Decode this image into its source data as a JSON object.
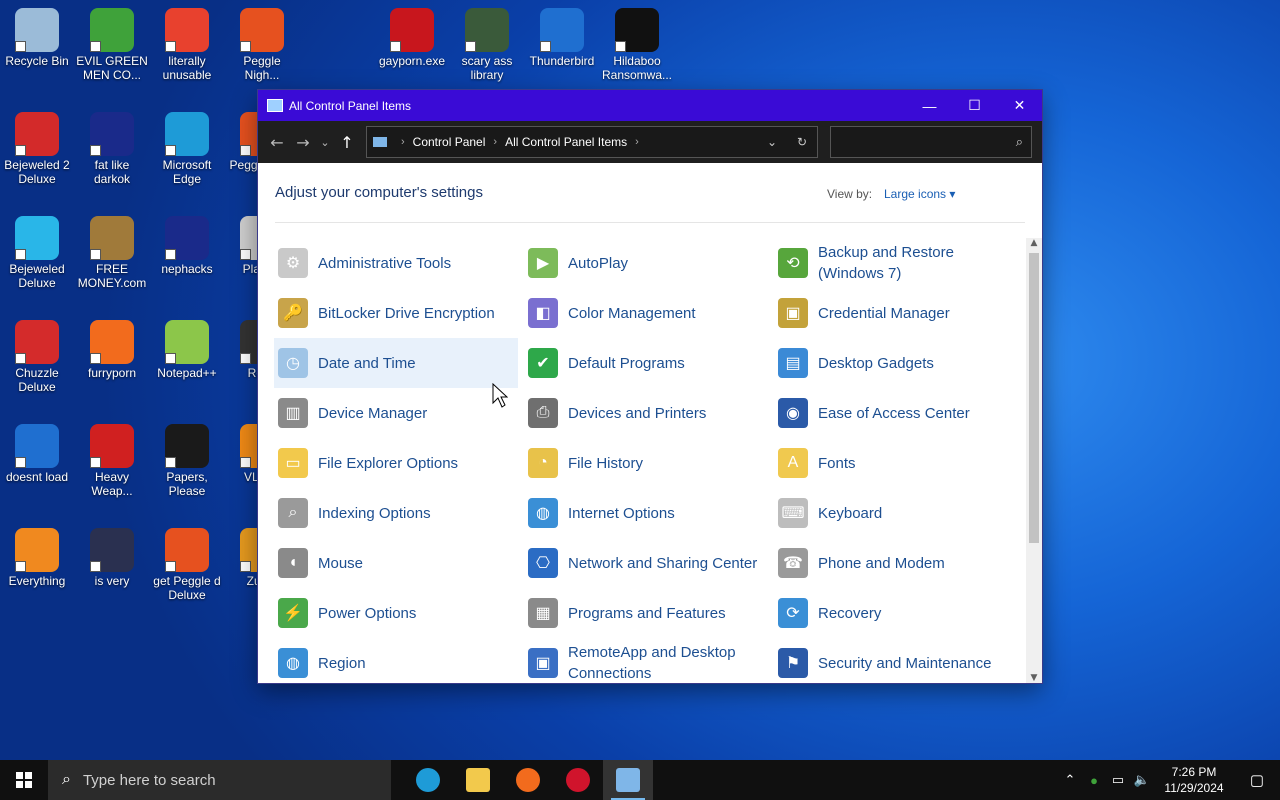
{
  "desktop": {
    "icons": [
      {
        "label": "Recycle Bin",
        "color": "#9bbbd8"
      },
      {
        "label": "EVIL GREEN MEN CO...",
        "color": "#3fa23a"
      },
      {
        "label": "literally unusable",
        "color": "#e8412e"
      },
      {
        "label": "Peggle Nigh...",
        "color": "#e6511f"
      },
      {
        "label": "gayporn.exe",
        "color": "#c8161d"
      },
      {
        "label": "scary ass library",
        "color": "#3a5a3a"
      },
      {
        "label": "Thunderbird",
        "color": "#1f6fd0"
      },
      {
        "label": "Hildaboo Ransomwa...",
        "color": "#111111"
      },
      {
        "label": "Bejeweled 2 Deluxe",
        "color": "#d32a2a"
      },
      {
        "label": "fat like darkok",
        "color": "#1a2a8a"
      },
      {
        "label": "Microsoft Edge",
        "color": "#1e9bd7"
      },
      {
        "label": "Peggl of Wa",
        "color": "#e6511f"
      },
      {
        "label": "Bejeweled Deluxe",
        "color": "#29b6e8"
      },
      {
        "label": "FREE MONEY.com",
        "color": "#a07a3a"
      },
      {
        "label": "nephacks",
        "color": "#1a2a8a"
      },
      {
        "label": "Pla Zor",
        "color": "#cfcfcf"
      },
      {
        "label": "Chuzzle Deluxe",
        "color": "#d42b2b"
      },
      {
        "label": "furryporn",
        "color": "#f26b1d"
      },
      {
        "label": "Notepad++",
        "color": "#8cc64a"
      },
      {
        "label": "Ro M",
        "color": "#333333"
      },
      {
        "label": "doesnt load",
        "color": "#1f6fd0"
      },
      {
        "label": "Heavy Weap...",
        "color": "#d02020"
      },
      {
        "label": "Papers, Please",
        "color": "#1a1a1a"
      },
      {
        "label": "VLC pl",
        "color": "#f08a16"
      },
      {
        "label": "Everything",
        "color": "#f0891f"
      },
      {
        "label": "is very",
        "color": "#2a3050"
      },
      {
        "label": "get Peggle d Deluxe",
        "color": "#e6511f"
      },
      {
        "label": "Zuma",
        "color": "#e69a1f"
      }
    ]
  },
  "window": {
    "title": "All Control Panel Items",
    "controls": {
      "minimize": "—",
      "maximize": "☐",
      "close": "✕"
    },
    "nav": {
      "back": "←",
      "forward": "→",
      "recent": "⌄",
      "up": "↑",
      "refresh": "↻",
      "dropdown": "⌄",
      "search_glyph": "⌕"
    },
    "breadcrumb": [
      "Control Panel",
      "All Control Panel Items"
    ],
    "search_placeholder": "",
    "heading": "Adjust your computer's settings",
    "view_by_label": "View by:",
    "view_by_value": "Large icons ▾",
    "items": [
      {
        "label": "Administrative Tools",
        "icon": "tools-icon",
        "color": "#c9c9c9",
        "glyph": "⚙"
      },
      {
        "label": "AutoPlay",
        "icon": "autoplay-icon",
        "color": "#7dbb5a",
        "glyph": "▶"
      },
      {
        "label": "Backup and Restore (Windows 7)",
        "icon": "backup-icon",
        "color": "#57a63c",
        "glyph": "⟲"
      },
      {
        "label": "BitLocker Drive Encryption",
        "icon": "bitlocker-icon",
        "color": "#c8a44a",
        "glyph": "🔑"
      },
      {
        "label": "Color Management",
        "icon": "color-management-icon",
        "color": "#7a6fd0",
        "glyph": "◧"
      },
      {
        "label": "Credential Manager",
        "icon": "credential-icon",
        "color": "#c3a23a",
        "glyph": "▣"
      },
      {
        "label": "Date and Time",
        "icon": "date-time-icon",
        "color": "#9fc4e6",
        "glyph": "◷"
      },
      {
        "label": "Default Programs",
        "icon": "default-programs-icon",
        "color": "#2ea84a",
        "glyph": "✔"
      },
      {
        "label": "Desktop Gadgets",
        "icon": "gadgets-icon",
        "color": "#3b8ad6",
        "glyph": "▤"
      },
      {
        "label": "Device Manager",
        "icon": "device-manager-icon",
        "color": "#8a8a8a",
        "glyph": "▥"
      },
      {
        "label": "Devices and Printers",
        "icon": "printer-icon",
        "color": "#6f6f6f",
        "glyph": "⎙"
      },
      {
        "label": "Ease of Access Center",
        "icon": "ease-access-icon",
        "color": "#2b5aa8",
        "glyph": "◉"
      },
      {
        "label": "File Explorer Options",
        "icon": "folder-options-icon",
        "color": "#f2c94c",
        "glyph": "▭"
      },
      {
        "label": "File History",
        "icon": "file-history-icon",
        "color": "#e8c24a",
        "glyph": "◔"
      },
      {
        "label": "Fonts",
        "icon": "fonts-icon",
        "color": "#f0c94f",
        "glyph": "A"
      },
      {
        "label": "Indexing Options",
        "icon": "indexing-icon",
        "color": "#9a9a9a",
        "glyph": "⌕"
      },
      {
        "label": "Internet Options",
        "icon": "internet-options-icon",
        "color": "#3a8fd6",
        "glyph": "◍"
      },
      {
        "label": "Keyboard",
        "icon": "keyboard-icon",
        "color": "#bdbdbd",
        "glyph": "⌨"
      },
      {
        "label": "Mouse",
        "icon": "mouse-icon",
        "color": "#8a8a8a",
        "glyph": "◖"
      },
      {
        "label": "Network and Sharing Center",
        "icon": "network-icon",
        "color": "#2b6cc4",
        "glyph": "⎔"
      },
      {
        "label": "Phone and Modem",
        "icon": "phone-modem-icon",
        "color": "#9a9a9a",
        "glyph": "☎"
      },
      {
        "label": "Power Options",
        "icon": "power-icon",
        "color": "#4aa84a",
        "glyph": "⚡"
      },
      {
        "label": "Programs and Features",
        "icon": "programs-icon",
        "color": "#8a8a8a",
        "glyph": "▦"
      },
      {
        "label": "Recovery",
        "icon": "recovery-icon",
        "color": "#3a8fd6",
        "glyph": "⟳"
      },
      {
        "label": "Region",
        "icon": "region-icon",
        "color": "#3a8fd6",
        "glyph": "◍"
      },
      {
        "label": "RemoteApp and Desktop Connections",
        "icon": "remoteapp-icon",
        "color": "#3a6fc4",
        "glyph": "▣"
      },
      {
        "label": "Security and Maintenance",
        "icon": "security-flag-icon",
        "color": "#2b5aa8",
        "glyph": "⚑"
      }
    ]
  },
  "taskbar": {
    "search_placeholder": "Type here to search",
    "apps": [
      {
        "name": "edge",
        "color": "#1e9bd7"
      },
      {
        "name": "file-explorer",
        "color": "#f2c94c"
      },
      {
        "name": "firefox",
        "color": "#f26b1d"
      },
      {
        "name": "opera",
        "color": "#d0142c"
      },
      {
        "name": "control-panel",
        "color": "#7fb6e8"
      }
    ],
    "tray": {
      "time": "7:26 PM",
      "date": "11/29/2024"
    }
  }
}
